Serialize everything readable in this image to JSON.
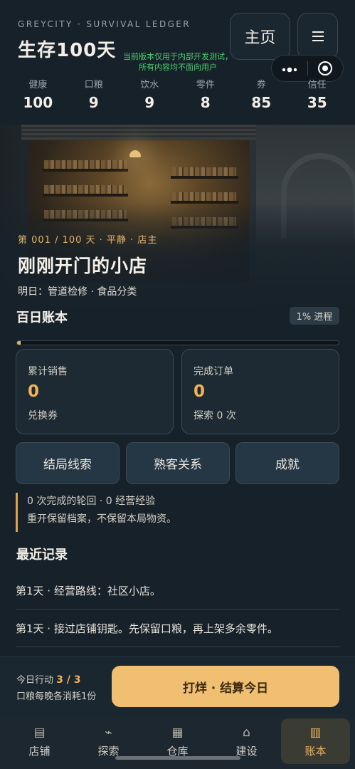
{
  "header": {
    "brand": "GREYCITY · SURVIVAL LEDGER",
    "title": "生存100天",
    "home_label": "主页",
    "menu_icon": "hamburger-icon",
    "dev_notice_line1": "当前版本仅用于内部开发测试，",
    "dev_notice_line2": "所有内容均不面向用户",
    "capsule_more": "•●•"
  },
  "stats": [
    {
      "label": "健康",
      "value": "100"
    },
    {
      "label": "口粮",
      "value": "9"
    },
    {
      "label": "饮水",
      "value": "9"
    },
    {
      "label": "零件",
      "value": "8"
    },
    {
      "label": "券",
      "value": "85"
    },
    {
      "label": "信任",
      "value": "35"
    }
  ],
  "hero": {
    "day_line": "第 001 / 100 天 · 平静 · 店主",
    "shop_name": "刚刚开门的小店",
    "tomorrow": "明日：管道检修 · 食品分类"
  },
  "ledger": {
    "title": "百日账本",
    "progress_label": "1% 进程",
    "progress_fraction": 0.01,
    "cards": [
      {
        "label": "累计销售",
        "value": "0",
        "sub": "兑换券"
      },
      {
        "label": "完成订单",
        "value": "0",
        "sub": "探索 0 次"
      }
    ],
    "buttons": [
      "结局线索",
      "熟客关系",
      "成就"
    ],
    "note_line1": "0 次完成的轮回 · 0 经营经验",
    "note_line2": "重开保留档案，不保留本局物资。"
  },
  "recent": {
    "title": "最近记录",
    "items": [
      "第1天 · 经营路线：社区小店。",
      "第1天 · 接过店铺钥匙。先保留口粮，再上架多余零件。"
    ]
  },
  "action_bar": {
    "label": "今日行动",
    "count": "3 / 3",
    "sub": "口粮每晚各消耗1份",
    "button": "打烊 · 结算今日"
  },
  "nav": [
    {
      "label": "店铺",
      "icon": "▤"
    },
    {
      "label": "探索",
      "icon": "⌁"
    },
    {
      "label": "仓库",
      "icon": "▦"
    },
    {
      "label": "建设",
      "icon": "⌂"
    },
    {
      "label": "账本",
      "icon": "▥"
    }
  ],
  "colors": {
    "accent": "#f0b35a",
    "background": "#16212a",
    "dev_notice": "#4bd16b"
  }
}
